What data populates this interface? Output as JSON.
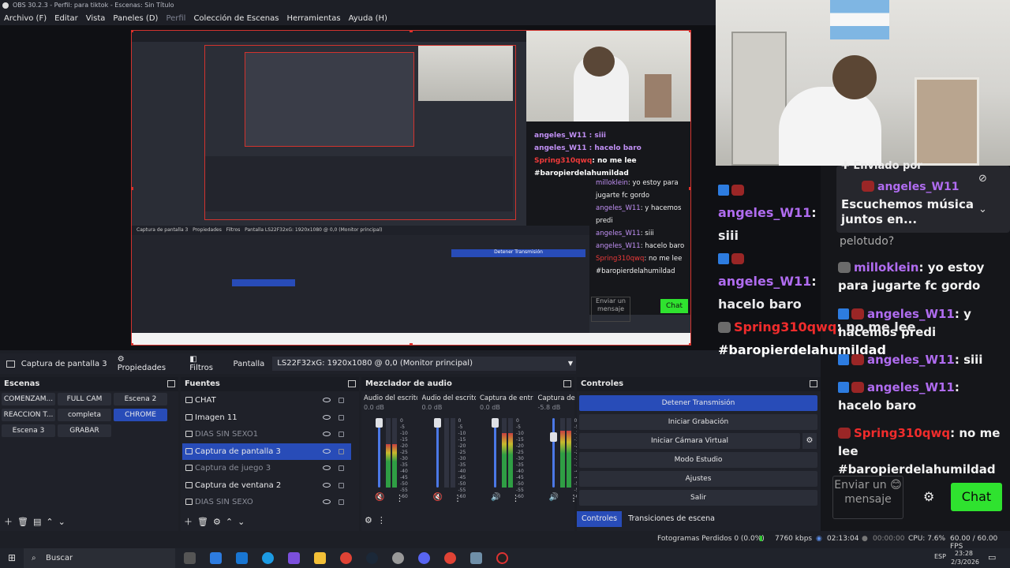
{
  "window": {
    "title": "OBS 30.2.3 - Perfil: para tiktok - Escenas: Sin Título"
  },
  "menu": [
    {
      "label": "Archivo (F)",
      "dim": false
    },
    {
      "label": "Editar",
      "dim": false
    },
    {
      "label": "Vista",
      "dim": false
    },
    {
      "label": "Paneles (D)",
      "dim": false
    },
    {
      "label": "Perfil",
      "dim": true
    },
    {
      "label": "Colección de Escenas",
      "dim": false
    },
    {
      "label": "Herramientas",
      "dim": false
    },
    {
      "label": "Ayuda (H)",
      "dim": false
    }
  ],
  "source_bar": {
    "current_source": "Captura de pantalla 3",
    "properties": "Propiedades",
    "filters": "Filtros",
    "display_label": "Pantalla",
    "display_value": "LS22F32xG: 1920x1080 @ 0,0 (Monitor principal)"
  },
  "scenes": {
    "title": "Escenas",
    "items": [
      {
        "label": "COMENZAM...",
        "selected": false
      },
      {
        "label": "FULL CAM",
        "selected": false
      },
      {
        "label": "Escena 2",
        "selected": false
      },
      {
        "label": "REACCION T...",
        "selected": false
      },
      {
        "label": "completa",
        "selected": false
      },
      {
        "label": "CHROME",
        "selected": true
      },
      {
        "label": "Escena 3",
        "selected": false
      },
      {
        "label": "GRABAR",
        "selected": false
      }
    ]
  },
  "sources": {
    "title": "Fuentes",
    "items": [
      {
        "label": "CHAT",
        "visible": true,
        "selected": false
      },
      {
        "label": "Imagen 11",
        "visible": true,
        "selected": false
      },
      {
        "label": "DIAS SIN SEXO1",
        "visible": false,
        "selected": false
      },
      {
        "label": "Captura de pantalla 3",
        "visible": true,
        "selected": true
      },
      {
        "label": "Captura de juego 3",
        "visible": false,
        "selected": false
      },
      {
        "label": "Captura de ventana 2",
        "visible": true,
        "selected": false
      },
      {
        "label": "DIAS SIN SEXO",
        "visible": false,
        "selected": false
      }
    ]
  },
  "mixer": {
    "title": "Mezclador de audio",
    "channels": [
      {
        "name": "Audio del escrito",
        "db": "0.0 dB",
        "level": 0.62
      },
      {
        "name": "Audio del escrito",
        "db": "0.0 dB",
        "level": 0.0
      },
      {
        "name": "Captura de entra",
        "db": "0.0 dB",
        "level": 0.78
      },
      {
        "name": "Captura de",
        "db": "-5.8 dB",
        "level": 0.82
      }
    ],
    "scale": [
      "0",
      "-5",
      "-10",
      "-15",
      "-20",
      "-25",
      "-30",
      "-35",
      "-40",
      "-45",
      "-50",
      "-55",
      "-60"
    ]
  },
  "controls": {
    "title": "Controles",
    "buttons": [
      "Detener Transmisión",
      "Iniciar Grabación",
      "Iniciar Cámara Virtual",
      "Modo Estudio",
      "Ajustes",
      "Salir"
    ],
    "tabs": [
      "Controles",
      "Transiciones de escena"
    ]
  },
  "status": {
    "dropped": "Fotogramas Perdidos 0 (0.0%)",
    "bitrate": "7760 kbps",
    "stream_time": "02:13:04",
    "rec_time": "00:00:00",
    "cpu": "CPU: 7.6%",
    "fps": "60.00 / 60.00 FPS"
  },
  "taskbar": {
    "search": "Buscar",
    "lang": "ESP",
    "time": "23:28",
    "date": "2/3/2026"
  },
  "chat": {
    "pinned_label": "Enviado por",
    "pinned_user": "angeles_W11",
    "pinned_text": "Escuchemos música juntos en...",
    "overlap_lines": [
      {
        "user": "angeles_W11",
        "text": ": siii"
      },
      {
        "user": "angeles_W11",
        "text": ": hacelo baro"
      },
      {
        "user": "Spring310qwq",
        "text": ": no me lee"
      }
    ],
    "hashtag": "#baropierdelahumildad",
    "ghost": "pelotudo?",
    "messages": [
      {
        "user": "milloklein",
        "text": ": yo estoy para jugarte fc gordo",
        "kind": "gray"
      },
      {
        "user": "angeles_W11",
        "text": ": y hacemos predi",
        "kind": "purple"
      },
      {
        "user": "angeles_W11",
        "text": ": siii",
        "kind": "purple"
      },
      {
        "user": "angeles_W11",
        "text": ": hacelo baro",
        "kind": "purple"
      },
      {
        "user": "Spring310qwq",
        "text": ": no me lee #baropierdelahumildad",
        "kind": "red"
      }
    ],
    "input_placeholder": "Enviar un 😊 mensaje",
    "send": "Chat"
  }
}
